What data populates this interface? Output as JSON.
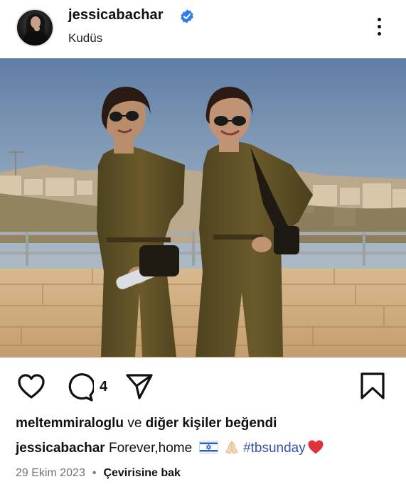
{
  "post": {
    "username": "jessicabachar",
    "location": "Kudüs",
    "verified": true
  },
  "actions": {
    "comment_count": "4"
  },
  "likes": {
    "user": "meltemmiraloglu",
    "connector": " ve ",
    "others": "diğer kişiler beğendi"
  },
  "caption": {
    "username": "jessicabachar",
    "text": "Forever,home",
    "emojis": [
      "israel-flag",
      "folded-hands"
    ],
    "hashtag": "#tbsunday",
    "end_emoji": "red-heart"
  },
  "meta": {
    "date": "29 Ekim 2023",
    "separator": "•",
    "translate_label": "Çevirisine bak"
  },
  "colors": {
    "verified_badge": "#2f7bef",
    "hashtag": "#3554a8",
    "heart": "#e0323a",
    "muted_text": "#737373"
  }
}
